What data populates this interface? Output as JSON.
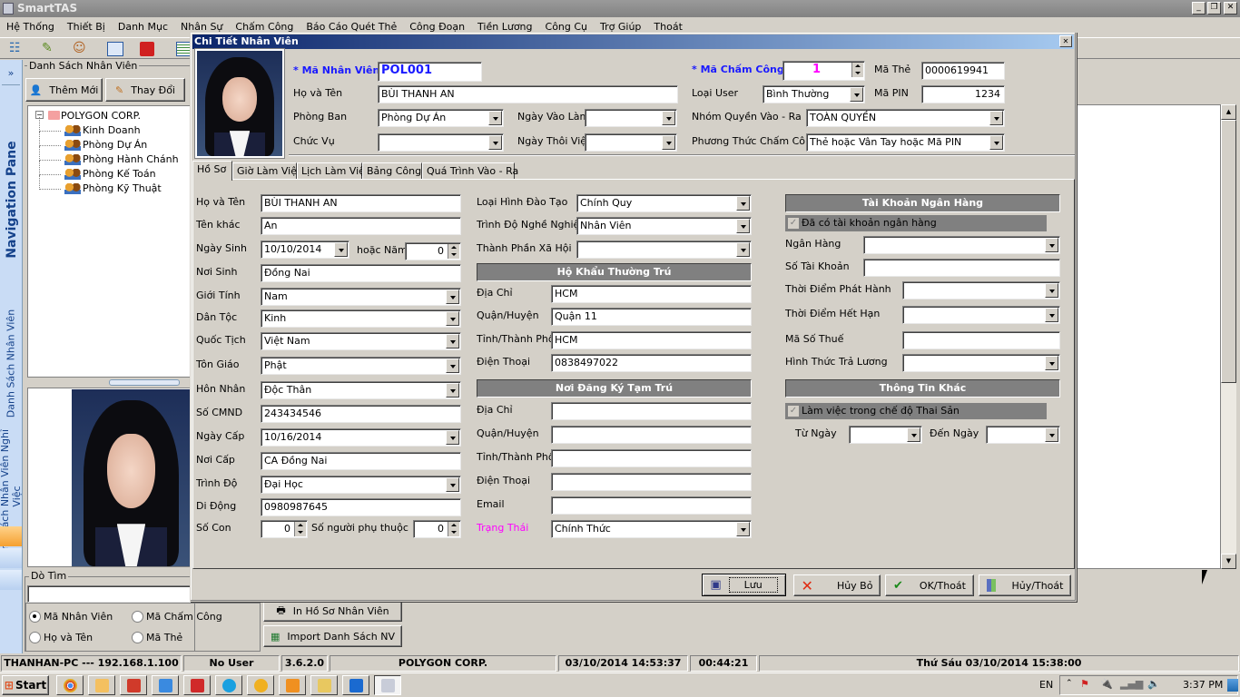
{
  "app": {
    "title": "SmartTAS"
  },
  "menu": [
    "Hệ Thống",
    "Thiết Bị",
    "Danh Mục",
    "Nhân Sự",
    "Chấm Công",
    "Báo Cáo Quét Thẻ",
    "Công Đoạn",
    "Tiền Lương",
    "Công Cụ",
    "Trợ Giúp",
    "Thoát"
  ],
  "nav_pane": {
    "expand": "»",
    "title": "Navigation Pane",
    "items": [
      "Danh Sách Nhân Viên",
      "Danh Sách Nhân Viên Nghỉ Việc"
    ]
  },
  "left_panel": {
    "group_title": "Danh Sách Nhân Viên",
    "add_button": "Thêm Mới",
    "edit_button": "Thay Đổi",
    "tree": {
      "root": "POLYGON CORP.",
      "children": [
        "Kinh Doanh",
        "Phòng Dự Án",
        "Phòng Hành Chánh",
        "Phòng Kế Toán",
        "Phòng Kỹ Thuật"
      ]
    },
    "search": {
      "title": "Dò Tìm",
      "value": "",
      "options": [
        {
          "label": "Mã Nhân Viên",
          "checked": true
        },
        {
          "label": "Mã Chấm Công",
          "checked": false
        },
        {
          "label": "Họ và Tên",
          "checked": false
        },
        {
          "label": "Mã Thẻ",
          "checked": false
        }
      ]
    },
    "print_button": "In Hồ Sơ Nhân Viên",
    "import_button": "Import Danh Sách NV"
  },
  "dialog": {
    "title": "Chi Tiết Nhân Viên",
    "header": [
      {
        "label": "* Mã Nhân Viên",
        "value": "POL001"
      },
      {
        "label": "Họ và Tên",
        "value": "BÙI THANH AN"
      },
      {
        "label": "Phòng Ban",
        "value": "Phòng Dự Án"
      },
      {
        "label": "Chức Vụ",
        "value": ""
      },
      {
        "label": "Ngày Vào Làm",
        "value": ""
      },
      {
        "label": "Ngày Thôi Việc",
        "value": ""
      },
      {
        "label": "* Mã Chấm Công",
        "value": "1"
      },
      {
        "label": "Loại User",
        "value": "Bình Thường"
      },
      {
        "label": "Mã Thẻ",
        "value": "0000619941"
      },
      {
        "label": "Mã PIN",
        "value": "1234"
      },
      {
        "label": "Nhóm Quyền Vào - Ra",
        "value": "TOÀN QUYỀN"
      },
      {
        "label": "Phương Thức Chấm Công",
        "value": "Thẻ hoặc Vân Tay hoặc Mã PIN"
      }
    ],
    "tabs": [
      {
        "label": "Hồ Sơ",
        "active": true
      },
      {
        "label": "Giờ Làm Việc",
        "active": false
      },
      {
        "label": "Lịch Làm Việc",
        "active": false
      },
      {
        "label": "Bảng Công",
        "active": false
      },
      {
        "label": "Quá Trình Vào - Ra",
        "active": false
      }
    ],
    "profile": {
      "col1": [
        {
          "label": "Họ và Tên",
          "value": "BÙI THANH AN"
        },
        {
          "label": "Tên khác",
          "value": "An"
        },
        {
          "label": "Ngày Sinh",
          "value": "10/10/2014"
        },
        {
          "label": "Nơi Sinh",
          "value": "Đồng Nai"
        },
        {
          "label": "Giới Tính",
          "value": "Nam"
        },
        {
          "label": "Dân Tộc",
          "value": "Kinh"
        },
        {
          "label": "Quốc Tịch",
          "value": "Việt Nam"
        },
        {
          "label": "Tôn Giáo",
          "value": "Phật"
        },
        {
          "label": "Hôn Nhân",
          "value": "Độc Thân"
        },
        {
          "label": "Số CMND",
          "value": "243434546"
        },
        {
          "label": "Ngày Cấp",
          "value": "10/16/2014"
        },
        {
          "label": "Nơi Cấp",
          "value": "CA Đồng Nai"
        },
        {
          "label": "Trình Độ",
          "value": "Đại Học"
        },
        {
          "label": "Di Động",
          "value": "0980987645"
        },
        {
          "label": "Số Con",
          "value": "0"
        },
        {
          "label": "hoặc Năm",
          "value": "0"
        },
        {
          "label": "Số người phụ thuộc",
          "value": "0"
        }
      ],
      "col2": [
        {
          "label": "Loại Hình Đào Tạo",
          "value": "Chính Quy"
        },
        {
          "label": "Trình Độ Nghề Nghiệp",
          "value": "Nhân Viên"
        },
        {
          "label": "Thành Phần Xã Hội",
          "value": ""
        }
      ],
      "permanent_title": "Hộ Khẩu Thường Trú",
      "permanent": [
        {
          "label": "Địa Chỉ",
          "value": "HCM"
        },
        {
          "label": "Quận/Huyện",
          "value": "Quận 11"
        },
        {
          "label": "Tỉnh/Thành Phố",
          "value": "HCM"
        },
        {
          "label": "Điện Thoại",
          "value": "0838497022"
        }
      ],
      "temporary_title": "Nơi Đăng Ký Tạm Trú",
      "temporary": [
        {
          "label": "Địa Chỉ",
          "value": ""
        },
        {
          "label": "Quận/Huyện",
          "value": ""
        },
        {
          "label": "Tỉnh/Thành Phố",
          "value": ""
        },
        {
          "label": "Điện Thoại",
          "value": ""
        },
        {
          "label": "Email",
          "value": ""
        }
      ],
      "status": {
        "label": "Trạng Thái",
        "value": "Chính Thức",
        "label_color": "#ff00ff"
      },
      "bank_title": "Tài Khoản Ngân Hàng",
      "bank_checkbox": {
        "label": "Đã có tài khoản ngân hàng",
        "checked": true
      },
      "bank": [
        {
          "label": "Ngân Hàng",
          "value": ""
        },
        {
          "label": "Số Tài Khoản",
          "value": ""
        },
        {
          "label": "Thời Điểm Phát Hành",
          "value": ""
        },
        {
          "label": "Thời Điểm Hết Hạn",
          "value": ""
        },
        {
          "label": "Mã Số Thuế",
          "value": ""
        },
        {
          "label": "Hình Thức Trả Lương",
          "value": ""
        }
      ],
      "other_title": "Thông Tin Khác",
      "maternity_checkbox": {
        "label": "Làm việc trong chế độ Thai Sản",
        "checked": true
      },
      "maternity": [
        {
          "label": "Từ Ngày",
          "value": ""
        },
        {
          "label": "Đến Ngày",
          "value": ""
        }
      ]
    },
    "buttons": {
      "save": "Lưu",
      "cancel": "Hủy Bỏ",
      "ok_exit": "OK/Thoát",
      "cancel_exit": "Hủy/Thoát"
    }
  },
  "status_bar": [
    "THANHAN-PC --- 192.168.1.100",
    "No User",
    "3.6.2.0",
    "POLYGON CORP.",
    "03/10/2014 14:53:37",
    "00:44:21",
    "Thứ Sáu 03/10/2014 15:38:00"
  ],
  "taskbar": {
    "start": "Start",
    "language": "EN",
    "clock": "3:37 PM"
  },
  "colors": {
    "required_label": "#1a1aff",
    "timekeeping_id": "#ff00ff",
    "dialog_title_bar": "#0a246a",
    "section_header": "#808080"
  }
}
